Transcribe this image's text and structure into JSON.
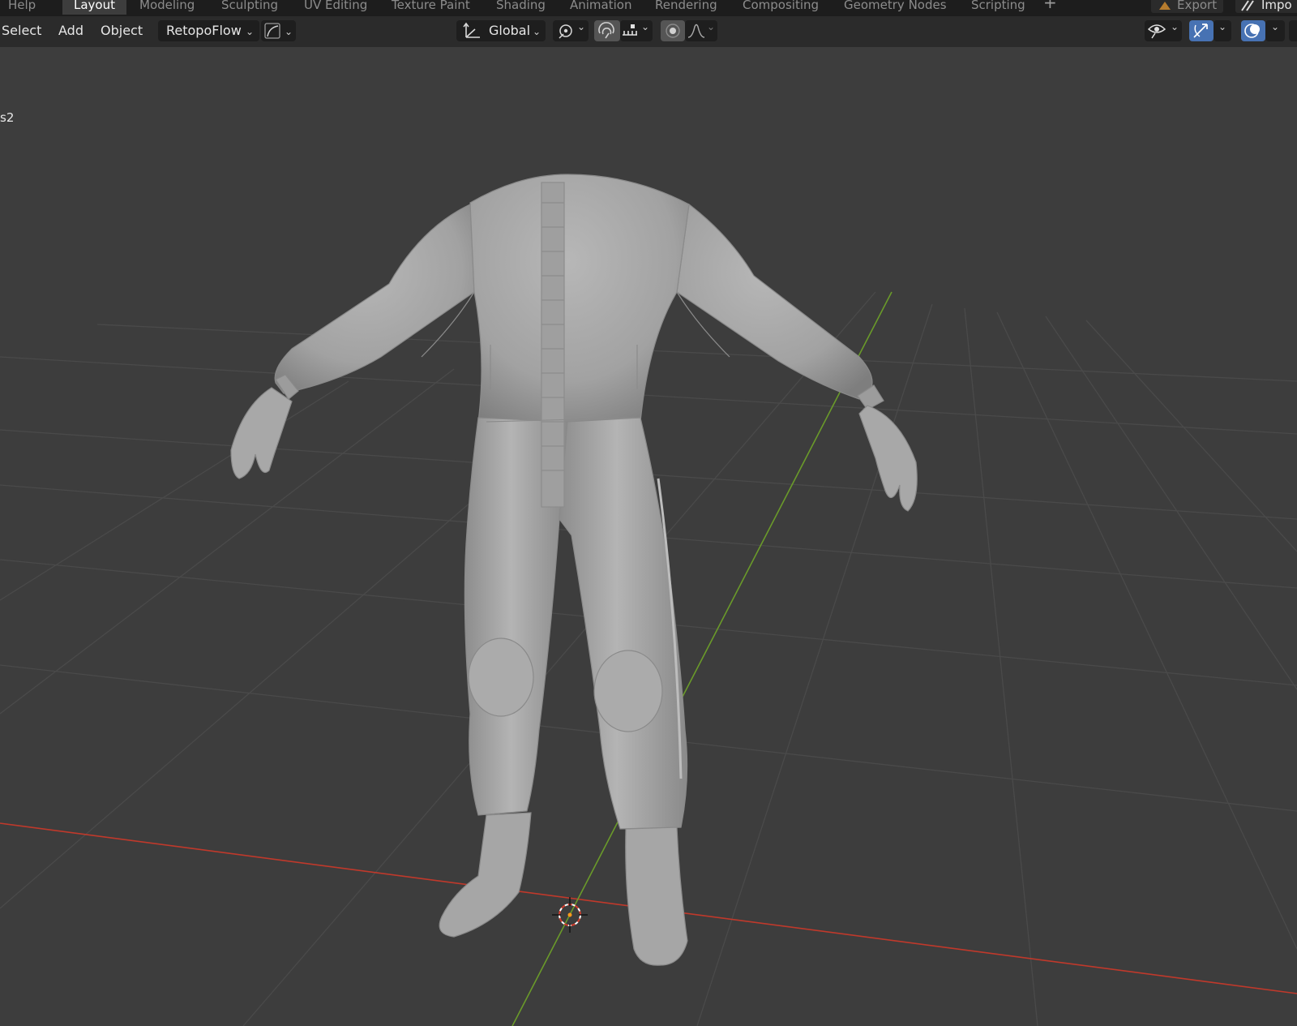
{
  "workspace_tabs": [
    {
      "label": "Help",
      "active": false
    },
    {
      "label": "Layout",
      "active": true
    },
    {
      "label": "Modeling",
      "active": false
    },
    {
      "label": "Sculpting",
      "active": false
    },
    {
      "label": "UV Editing",
      "active": false
    },
    {
      "label": "Texture Paint",
      "active": false
    },
    {
      "label": "Shading",
      "active": false
    },
    {
      "label": "Animation",
      "active": false
    },
    {
      "label": "Rendering",
      "active": false
    },
    {
      "label": "Compositing",
      "active": false
    },
    {
      "label": "Geometry Nodes",
      "active": false
    },
    {
      "label": "Scripting",
      "active": false
    }
  ],
  "add_workspace": "+",
  "top_right": {
    "export_label": "Export",
    "import_label": "Impo"
  },
  "menus": {
    "select": "Select",
    "add": "Add",
    "object": "Object"
  },
  "retopoflow": {
    "label": "RetopoFlow"
  },
  "transform_orientation": {
    "label": "Global"
  },
  "viewport": {
    "object_label": "s2"
  },
  "icons": {
    "orientation": "transform-orientation-icon",
    "pivot": "pivot-point-icon",
    "snap": "snap-magnet-icon",
    "snap_target": "snap-increment-icon",
    "proportional": "proportional-editing-icon",
    "falloff": "falloff-curve-icon",
    "visibility": "visibility-eye-icon",
    "gizmo": "gizmo-icon",
    "overlay": "overlay-icon"
  },
  "colors": {
    "viewport_bg": "#3d3d3d",
    "header_bg": "#2b2b2b",
    "active_button": "#4772b3",
    "x_axis": "#c0392b",
    "y_axis": "#6a9a2a",
    "mesh": "#a9a9a9"
  }
}
